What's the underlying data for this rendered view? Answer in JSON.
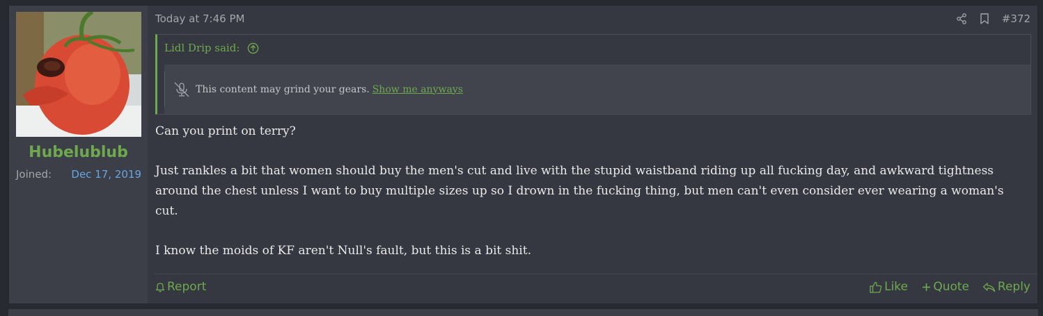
{
  "user": {
    "username": "Hubelublub",
    "joined_label": "Joined:",
    "joined_date": "Dec 17, 2019",
    "avatar": "tomato-face-avatar"
  },
  "post": {
    "timestamp": "Today at 7:46 PM",
    "number": "#372",
    "icons": [
      "share-icon",
      "bookmark-icon"
    ],
    "quote": {
      "author_said": "Lidl Drip said:",
      "spoiler_text": "This content may grind your gears.",
      "spoiler_link": "Show me anyways"
    },
    "body": [
      "Can you print on terry?",
      "Just rankles a bit that women should buy the men's cut and live with the stupid waistband riding up all fucking day, and awkward tightness around the chest unless I want to buy multiple sizes up so I drown in the fucking thing, but men can't even consider ever wearing a woman's cut.",
      "I know the moids of KF aren't Null's fault, but this is a bit shit."
    ]
  },
  "footer": {
    "report": "Report",
    "like": "Like",
    "quote": "Quote",
    "reply": "Reply"
  },
  "colors": {
    "accent": "#6fa94e",
    "link_blue": "#67a6e0",
    "background": "#353840"
  }
}
